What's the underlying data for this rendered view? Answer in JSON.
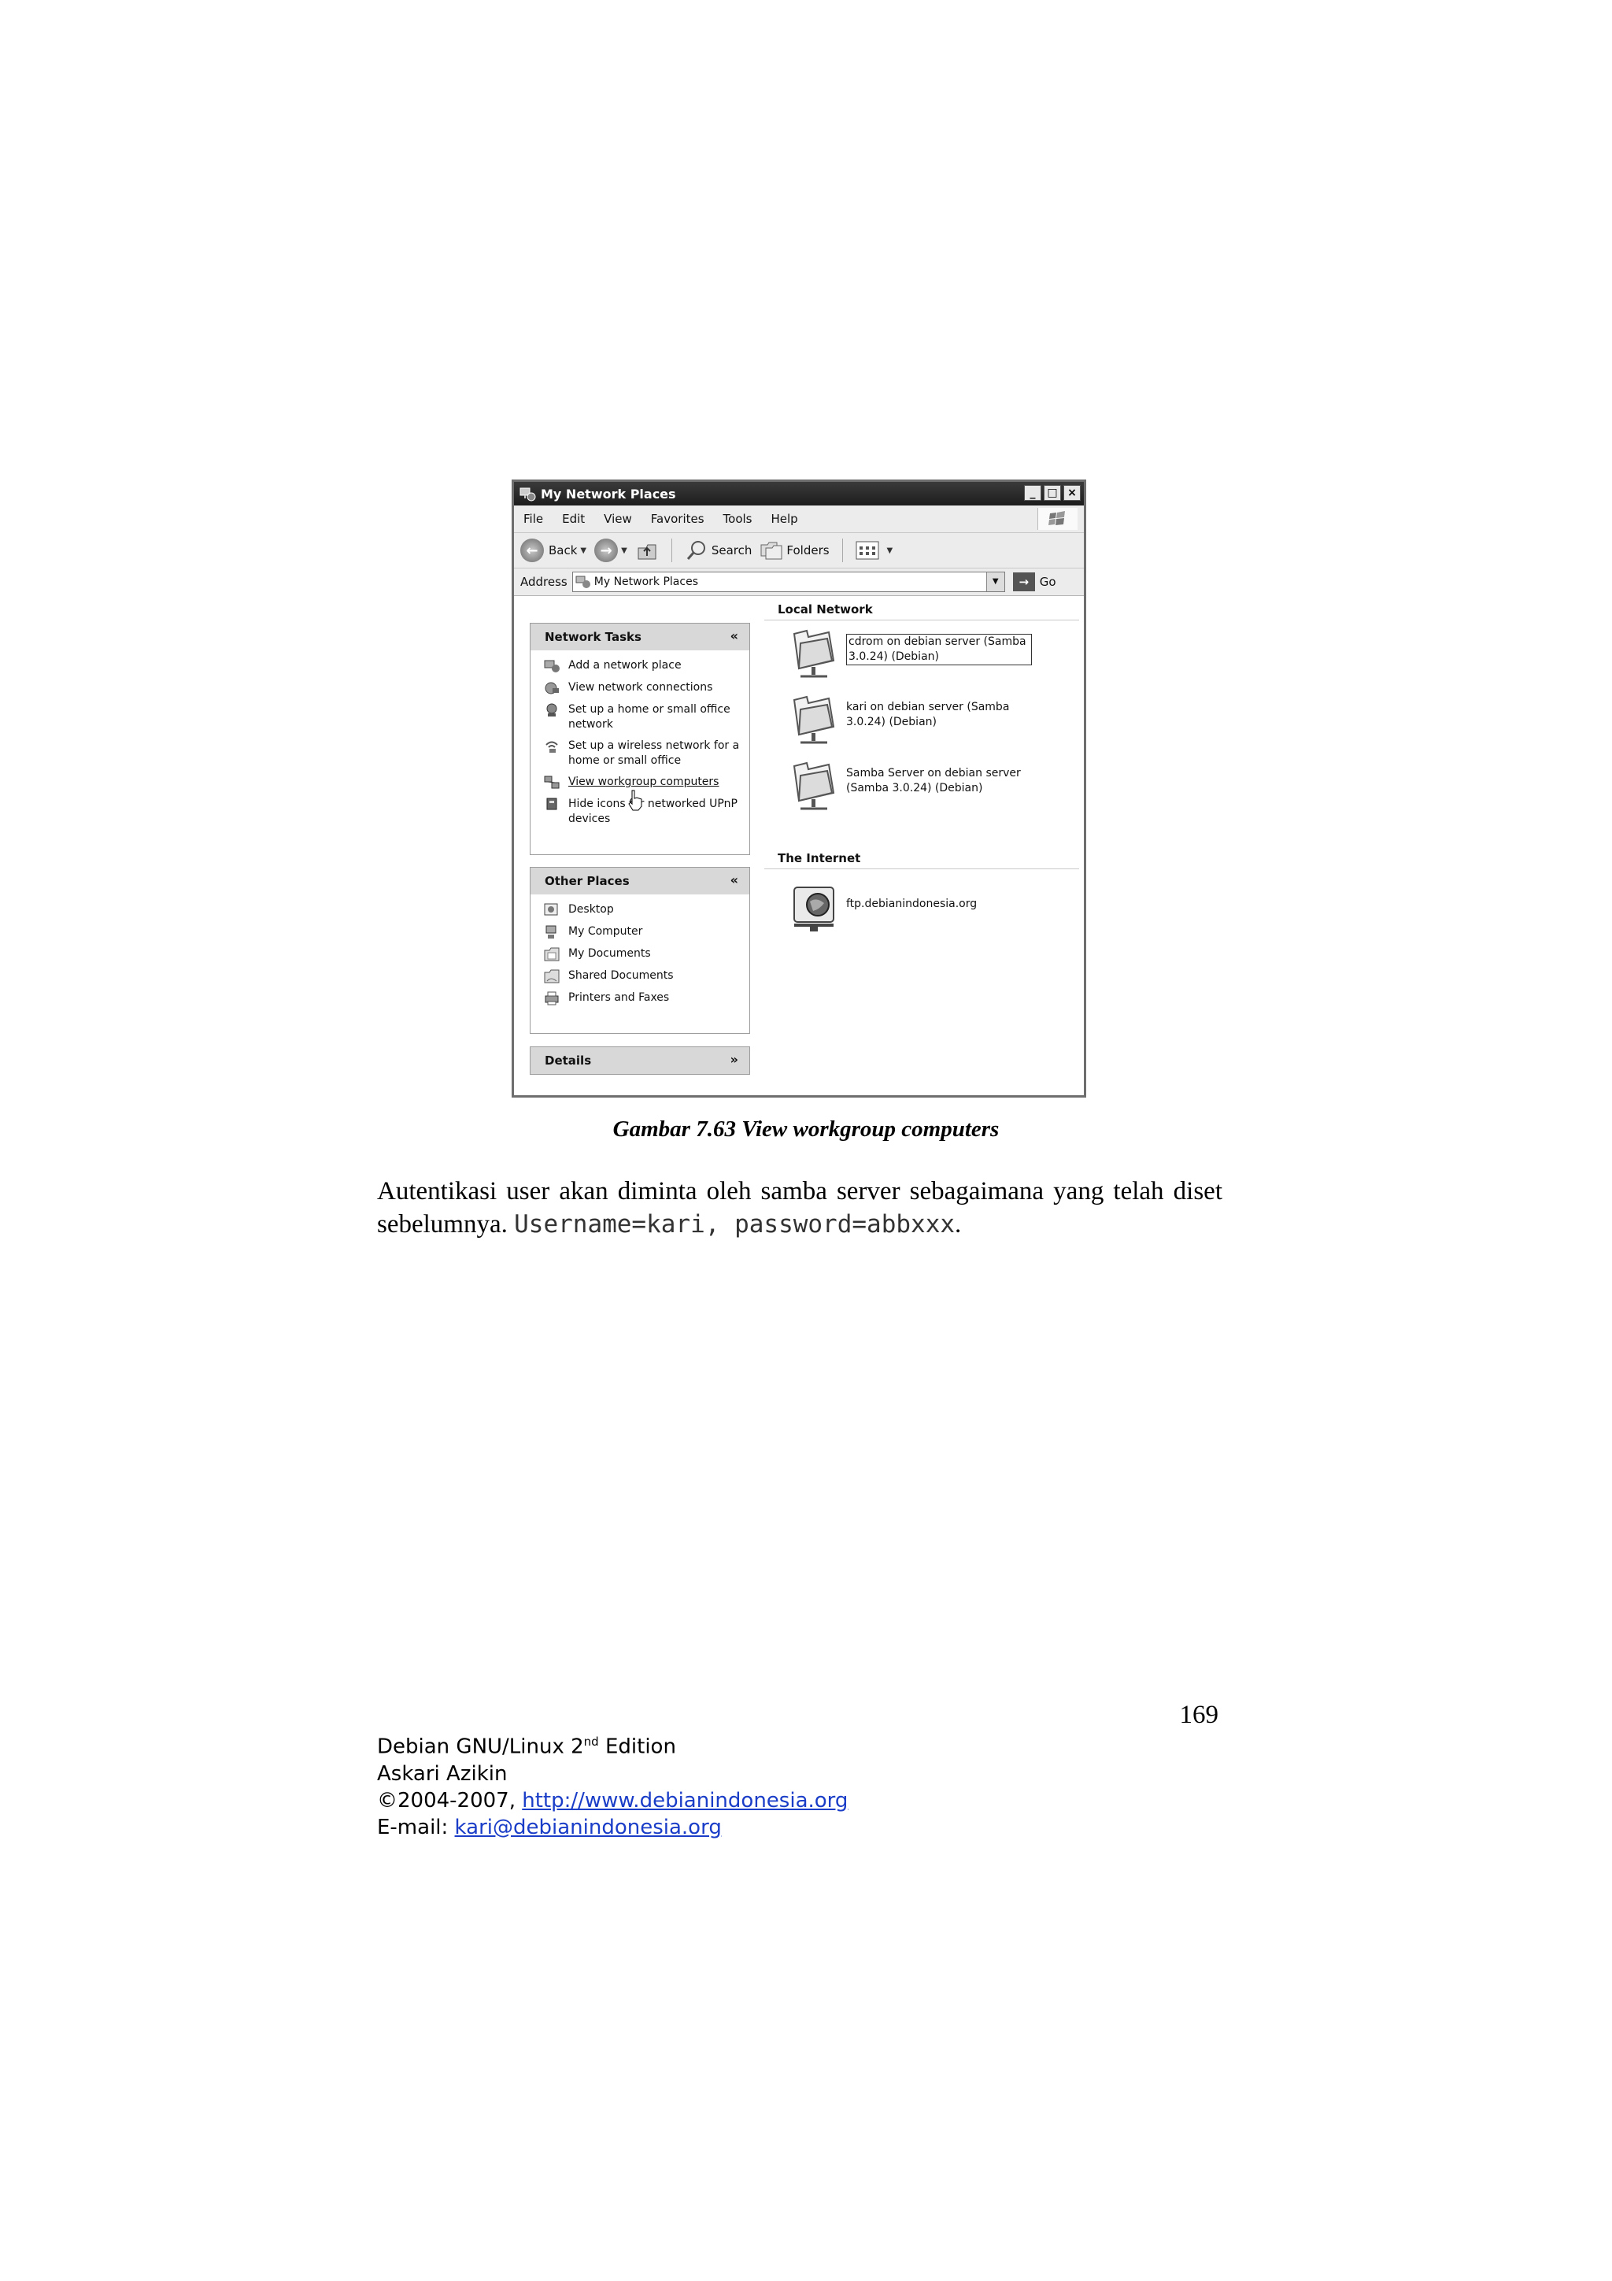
{
  "window": {
    "title": "My Network Places",
    "menu": [
      "File",
      "Edit",
      "View",
      "Favorites",
      "Tools",
      "Help"
    ],
    "toolbar": {
      "back": "Back",
      "search": "Search",
      "folders": "Folders"
    },
    "address": {
      "label": "Address",
      "value": "My Network Places",
      "go": "Go"
    },
    "network_tasks": {
      "title": "Network Tasks",
      "items": [
        "Add a network place",
        "View network connections",
        "Set up a home or small office network",
        "Set up a wireless network for a home or small office",
        "View workgroup computers",
        "Hide icons for networked UPnP devices"
      ]
    },
    "other_places": {
      "title": "Other Places",
      "items": [
        "Desktop",
        "My Computer",
        "My Documents",
        "Shared Documents",
        "Printers and Faxes"
      ]
    },
    "details": {
      "title": "Details"
    },
    "local_network": {
      "title": "Local Network",
      "items": [
        "cdrom on debian server (Samba 3.0.24) (Debian)",
        "kari on debian server (Samba 3.0.24) (Debian)",
        "Samba Server on debian server (Samba 3.0.24) (Debian)"
      ]
    },
    "internet": {
      "title": "The Internet",
      "items": [
        "ftp.debianindonesia.org"
      ]
    }
  },
  "caption": "Gambar 7.63 View workgroup computers",
  "body": {
    "text": "Autentikasi user akan diminta oleh samba server sebagaimana yang telah diset sebelumnya.",
    "code": "Username=kari, password=abbxxx",
    "end": "."
  },
  "page_number": "169",
  "footer": {
    "line1_prefix": "Debian GNU/Linux 2",
    "line1_sup": "nd",
    "line1_suffix": " Edition",
    "author": "Askari Azikin",
    "copyright_prefix": "©2004-2007, ",
    "url": "http://www.debianindonesia.org",
    "email_prefix": "E-mail: ",
    "email": "kari@debianindonesia.org"
  }
}
